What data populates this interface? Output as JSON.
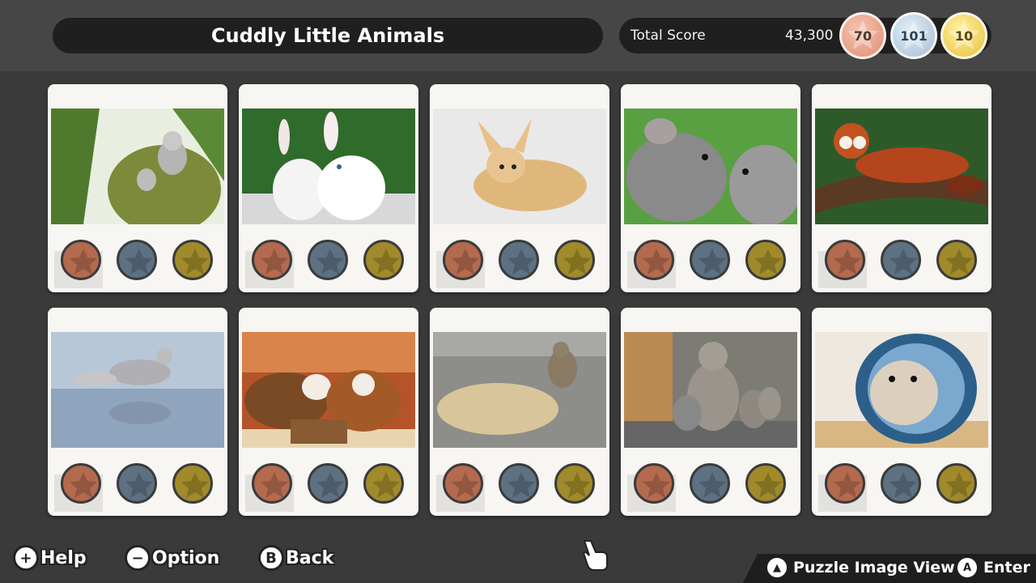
{
  "header": {
    "title": "Cuddly Little Animals",
    "score_label": "Total Score",
    "score_value": "43,300",
    "medals": {
      "bronze": "70",
      "silver": "101",
      "gold": "10"
    }
  },
  "colors": {
    "bronze": "#b46a4e",
    "silver": "#5d7183",
    "gold": "#a08a2a",
    "card": "#f7f6f2",
    "background": "#3a3a3a"
  },
  "puzzles": [
    {
      "subject": "sugar-gliders-on-durian",
      "icon": "puzzle-photo"
    },
    {
      "subject": "white-rabbits",
      "icon": "puzzle-photo"
    },
    {
      "subject": "fennec-fox",
      "icon": "puzzle-photo"
    },
    {
      "subject": "chinchillas",
      "icon": "puzzle-photo"
    },
    {
      "subject": "red-panda",
      "icon": "puzzle-photo"
    },
    {
      "subject": "arctic-fox",
      "icon": "puzzle-photo"
    },
    {
      "subject": "guinea-pigs",
      "icon": "puzzle-photo"
    },
    {
      "subject": "squirrel-with-peanuts",
      "icon": "puzzle-photo"
    },
    {
      "subject": "pallas-cats",
      "icon": "puzzle-photo"
    },
    {
      "subject": "hamster-in-wheel",
      "icon": "puzzle-photo"
    }
  ],
  "footer": {
    "help": {
      "glyph": "+",
      "label": "Help"
    },
    "option": {
      "glyph": "−",
      "label": "Option"
    },
    "back": {
      "glyph": "B",
      "label": "Back"
    },
    "puzzle_view": {
      "glyph": "▲",
      "label": "Puzzle Image View"
    },
    "enter": {
      "glyph": "A",
      "label": "Enter"
    }
  }
}
